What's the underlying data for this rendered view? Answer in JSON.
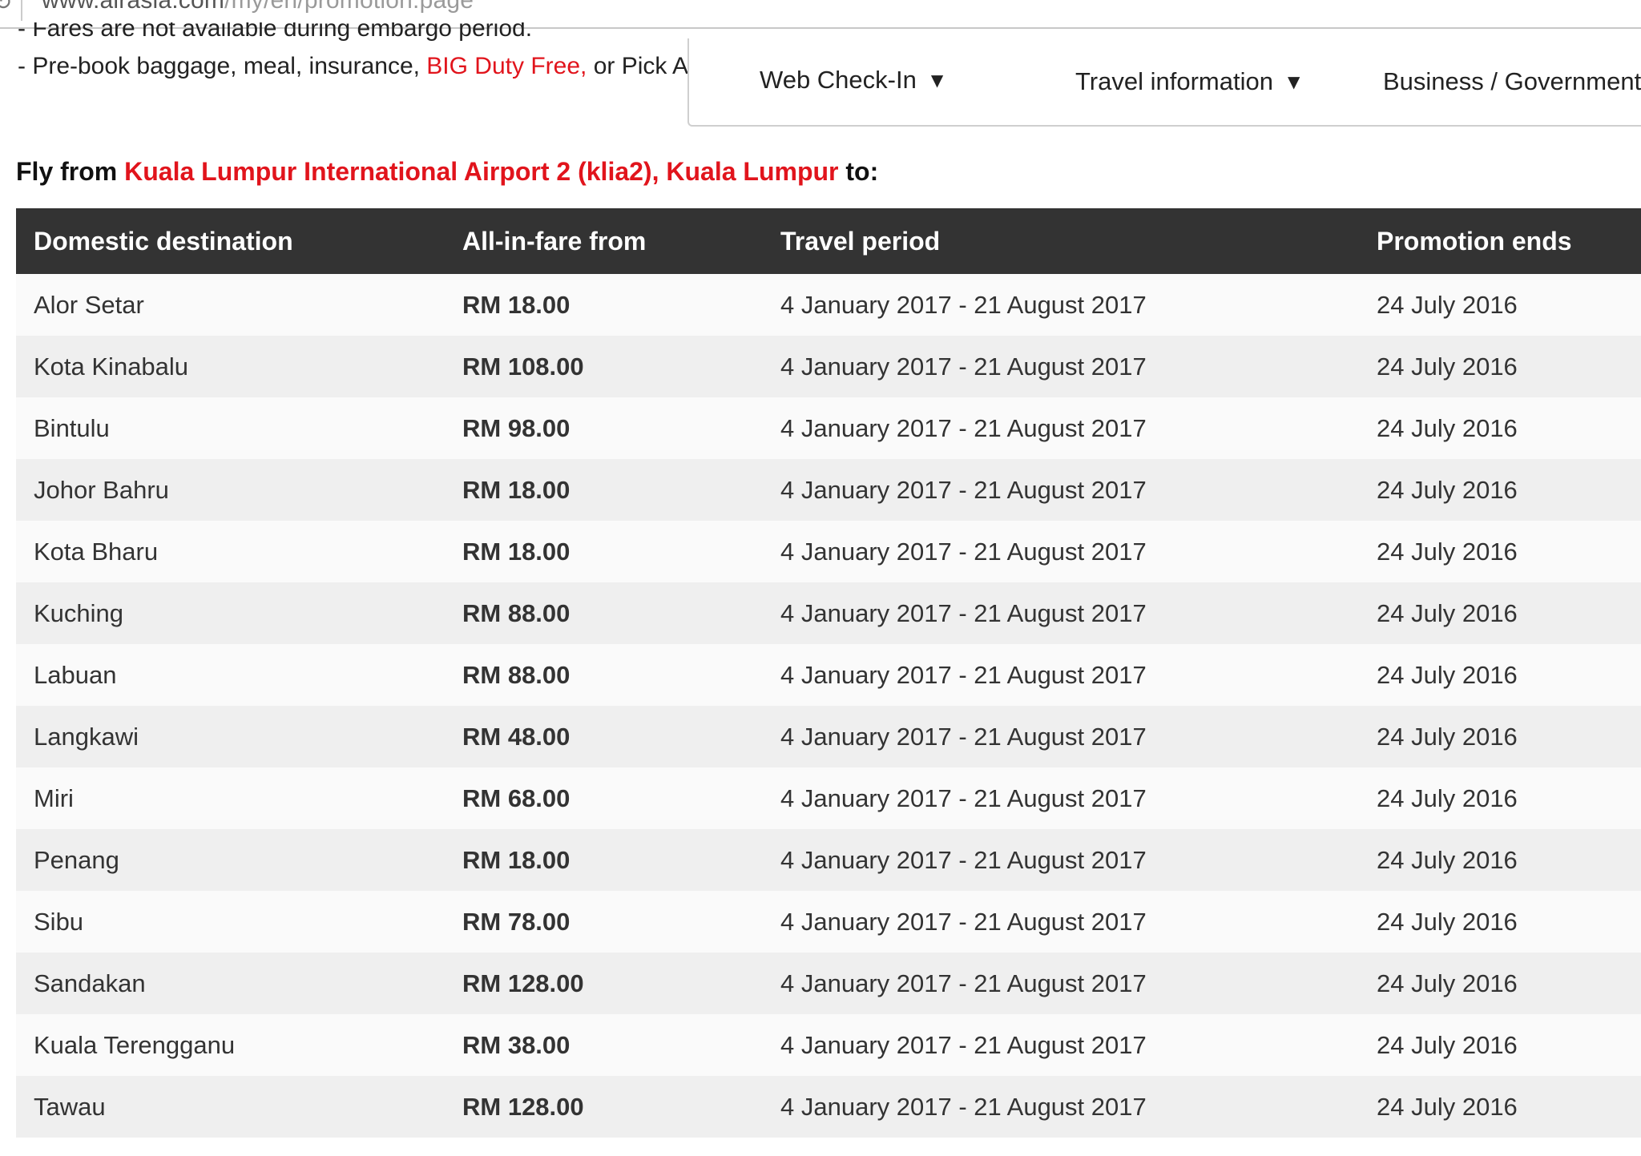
{
  "browser": {
    "url_domain": "www.airasia.com",
    "url_path": "/my/en/promotion.page"
  },
  "notes": {
    "cut_line": "- Fares are not available during embargo period.",
    "line_prefix": "- Pre-book baggage, meal, insurance, ",
    "line_link": "BIG Duty Free,",
    "line_suffix": " or Pick A Seat"
  },
  "nav": {
    "items": [
      {
        "label": "Web Check-In"
      },
      {
        "label": "Travel information"
      },
      {
        "label": "Business / Government"
      }
    ]
  },
  "heading": {
    "prefix": "Fly from ",
    "origin": "Kuala Lumpur International Airport 2 (klia2), Kuala Lumpur",
    "suffix": " to:"
  },
  "table": {
    "headers": [
      "Domestic destination",
      "All-in-fare from",
      "Travel period",
      "Promotion ends"
    ],
    "rows": [
      {
        "destination": "Alor Setar",
        "fare": "RM 18.00",
        "period": "4 January 2017 - 21 August 2017",
        "ends": "24 July 2016"
      },
      {
        "destination": "Kota Kinabalu",
        "fare": "RM 108.00",
        "period": "4 January 2017 - 21 August 2017",
        "ends": "24 July 2016"
      },
      {
        "destination": "Bintulu",
        "fare": "RM 98.00",
        "period": "4 January 2017 - 21 August 2017",
        "ends": "24 July 2016"
      },
      {
        "destination": "Johor Bahru",
        "fare": "RM 18.00",
        "period": "4 January 2017 - 21 August 2017",
        "ends": "24 July 2016"
      },
      {
        "destination": "Kota Bharu",
        "fare": "RM 18.00",
        "period": "4 January 2017 - 21 August 2017",
        "ends": "24 July 2016"
      },
      {
        "destination": "Kuching",
        "fare": "RM 88.00",
        "period": "4 January 2017 - 21 August 2017",
        "ends": "24 July 2016"
      },
      {
        "destination": "Labuan",
        "fare": "RM 88.00",
        "period": "4 January 2017 - 21 August 2017",
        "ends": "24 July 2016"
      },
      {
        "destination": "Langkawi",
        "fare": "RM 48.00",
        "period": "4 January 2017 - 21 August 2017",
        "ends": "24 July 2016"
      },
      {
        "destination": "Miri",
        "fare": "RM 68.00",
        "period": "4 January 2017 - 21 August 2017",
        "ends": "24 July 2016"
      },
      {
        "destination": "Penang",
        "fare": "RM 18.00",
        "period": "4 January 2017 - 21 August 2017",
        "ends": "24 July 2016"
      },
      {
        "destination": "Sibu",
        "fare": "RM 78.00",
        "period": "4 January 2017 - 21 August 2017",
        "ends": "24 July 2016"
      },
      {
        "destination": "Sandakan",
        "fare": "RM 128.00",
        "period": "4 January 2017 - 21 August 2017",
        "ends": "24 July 2016"
      },
      {
        "destination": "Kuala Terengganu",
        "fare": "RM 38.00",
        "period": "4 January 2017 - 21 August 2017",
        "ends": "24 July 2016"
      },
      {
        "destination": "Tawau",
        "fare": "RM 128.00",
        "period": "4 January 2017 - 21 August 2017",
        "ends": "24 July 2016"
      }
    ]
  },
  "colors": {
    "accent_red": "#e1141c",
    "header_bg": "#333333"
  }
}
